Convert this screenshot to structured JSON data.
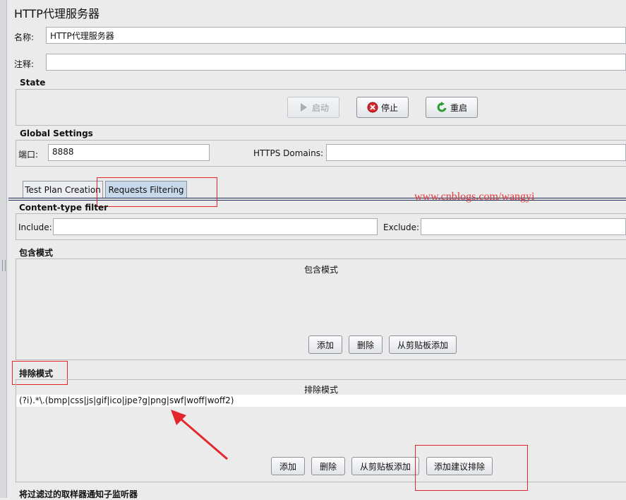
{
  "window": {
    "title": "HTTP代理服务器"
  },
  "name_field": {
    "label": "名称:",
    "value": "HTTP代理服务器"
  },
  "comment_field": {
    "label": "注释:",
    "value": ""
  },
  "state": {
    "heading": "State",
    "start_label": "启动",
    "stop_label": "停止",
    "restart_label": "重启"
  },
  "global_settings": {
    "heading": "Global Settings",
    "port_label": "端口:",
    "port_value": "8888",
    "https_label": "HTTPS Domains:",
    "https_value": ""
  },
  "tabs": [
    {
      "label": "Test Plan Creation",
      "selected": false
    },
    {
      "label": "Requests Filtering",
      "selected": true
    }
  ],
  "watermark": "www.cnblogs.com/wangyi",
  "content_type_filter": {
    "heading": "Content-type filter",
    "include_label": "Include:",
    "include_value": "",
    "exclude_label": "Exclude:",
    "exclude_value": ""
  },
  "include_patterns": {
    "heading": "包含模式",
    "table_header": "包含模式",
    "rows": [],
    "add_label": "添加",
    "delete_label": "删除",
    "paste_label": "从剪贴板添加"
  },
  "exclude_patterns": {
    "heading": "排除模式",
    "table_header": "排除模式",
    "rows": [
      "(?i).*\\.(bmp|css|js|gif|ico|jpe?g|png|swf|woff|woff2)"
    ],
    "add_label": "添加",
    "delete_label": "删除",
    "paste_label": "从剪贴板添加",
    "suggest_label": "添加建议排除"
  },
  "notify_section": {
    "heading": "将过滤过的取样器通知子监听器"
  },
  "colors": {
    "annotation_red": "#e2282d",
    "selected_tab": "#c6d8ea",
    "separator_navy": "#1f2a55"
  }
}
